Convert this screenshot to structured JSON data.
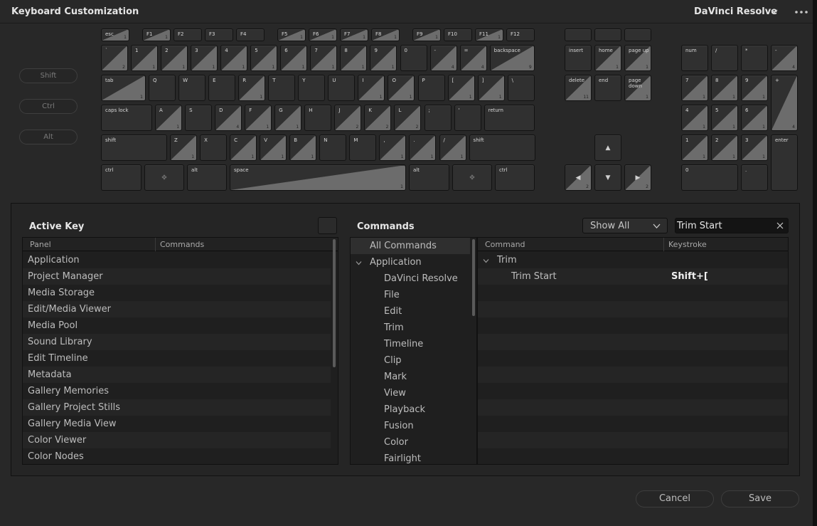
{
  "window": {
    "title": "Keyboard Customization",
    "preset": "DaVinci Resolve"
  },
  "modifiers": [
    "Shift",
    "Ctrl",
    "Alt"
  ],
  "keyboard": {
    "function_row": [
      {
        "label": "esc",
        "count": "1"
      },
      {
        "label": "F1",
        "count": "1"
      },
      {
        "label": "F2",
        "count": ""
      },
      {
        "label": "F3",
        "count": ""
      },
      {
        "label": "F4",
        "count": ""
      },
      {
        "label": "F5",
        "count": "1"
      },
      {
        "label": "F6",
        "count": "1"
      },
      {
        "label": "F7",
        "count": "1"
      },
      {
        "label": "F8",
        "count": "1"
      },
      {
        "label": "F9",
        "count": "1"
      },
      {
        "label": "F10",
        "count": ""
      },
      {
        "label": "F11",
        "count": "1"
      },
      {
        "label": "F12",
        "count": ""
      }
    ],
    "number_row": [
      {
        "label": "`",
        "count": "2"
      },
      {
        "label": "1",
        "count": "1"
      },
      {
        "label": "2",
        "count": "1"
      },
      {
        "label": "3",
        "count": "1"
      },
      {
        "label": "4",
        "count": "1"
      },
      {
        "label": "5",
        "count": "1"
      },
      {
        "label": "6",
        "count": "1"
      },
      {
        "label": "7",
        "count": "1"
      },
      {
        "label": "8",
        "count": "1"
      },
      {
        "label": "9",
        "count": "1"
      },
      {
        "label": "0",
        "count": ""
      },
      {
        "label": "-",
        "count": "4"
      },
      {
        "label": "=",
        "count": "4"
      },
      {
        "label": "backspace",
        "count": "9"
      }
    ],
    "tab_row": [
      {
        "label": "tab",
        "count": "1"
      },
      {
        "label": "Q",
        "count": ""
      },
      {
        "label": "W",
        "count": ""
      },
      {
        "label": "E",
        "count": ""
      },
      {
        "label": "R",
        "count": "1"
      },
      {
        "label": "T",
        "count": ""
      },
      {
        "label": "Y",
        "count": ""
      },
      {
        "label": "U",
        "count": ""
      },
      {
        "label": "I",
        "count": "1"
      },
      {
        "label": "O",
        "count": "1"
      },
      {
        "label": "P",
        "count": ""
      },
      {
        "label": "[",
        "count": "1"
      },
      {
        "label": "]",
        "count": "1"
      },
      {
        "label": "\\",
        "count": ""
      }
    ],
    "caps_row": [
      {
        "label": "caps lock",
        "count": ""
      },
      {
        "label": "A",
        "count": "1"
      },
      {
        "label": "S",
        "count": ""
      },
      {
        "label": "D",
        "count": "4"
      },
      {
        "label": "F",
        "count": "1"
      },
      {
        "label": "G",
        "count": "1"
      },
      {
        "label": "H",
        "count": ""
      },
      {
        "label": "J",
        "count": "2"
      },
      {
        "label": "K",
        "count": "2"
      },
      {
        "label": "L",
        "count": "2"
      },
      {
        "label": ";",
        "count": ""
      },
      {
        "label": "'",
        "count": ""
      },
      {
        "label": "return",
        "count": ""
      }
    ],
    "shift_row": [
      {
        "label": "shift",
        "count": ""
      },
      {
        "label": "Z",
        "count": "1"
      },
      {
        "label": "X",
        "count": ""
      },
      {
        "label": "C",
        "count": "1"
      },
      {
        "label": "V",
        "count": "1"
      },
      {
        "label": "B",
        "count": "1"
      },
      {
        "label": "N",
        "count": ""
      },
      {
        "label": "M",
        "count": ""
      },
      {
        "label": ",",
        "count": "1"
      },
      {
        "label": ".",
        "count": "1"
      },
      {
        "label": "/",
        "count": "1"
      },
      {
        "label": "shift",
        "count": ""
      }
    ],
    "bottom_row": [
      {
        "label": "ctrl",
        "count": ""
      },
      {
        "label": "",
        "count": "",
        "icon": "cmd-icon"
      },
      {
        "label": "alt",
        "count": ""
      },
      {
        "label": "space",
        "count": "1"
      },
      {
        "label": "alt",
        "count": ""
      },
      {
        "label": "",
        "count": "",
        "icon": "cmd-icon"
      },
      {
        "label": "ctrl",
        "count": ""
      }
    ],
    "nav_cluster": [
      {
        "label": "insert",
        "count": ""
      },
      {
        "label": "home",
        "count": "1"
      },
      {
        "label": "page up",
        "count": "1"
      },
      {
        "label": "delete",
        "count": "11"
      },
      {
        "label": "end",
        "count": ""
      },
      {
        "label": "page down",
        "count": "1"
      }
    ],
    "arrows": [
      {
        "label": "up-arrow",
        "count": ""
      },
      {
        "label": "left-arrow",
        "count": "2"
      },
      {
        "label": "down-arrow",
        "count": ""
      },
      {
        "label": "right-arrow",
        "count": "2"
      }
    ],
    "numpad": [
      {
        "label": "num",
        "count": ""
      },
      {
        "label": "/",
        "count": ""
      },
      {
        "label": "*",
        "count": ""
      },
      {
        "label": "-",
        "count": "4"
      },
      {
        "label": "7",
        "count": "1"
      },
      {
        "label": "8",
        "count": "1"
      },
      {
        "label": "9",
        "count": "1"
      },
      {
        "label": "+",
        "count": "4"
      },
      {
        "label": "4",
        "count": "1"
      },
      {
        "label": "5",
        "count": "1"
      },
      {
        "label": "6",
        "count": "1"
      },
      {
        "label": "1",
        "count": "1"
      },
      {
        "label": "2",
        "count": "1"
      },
      {
        "label": "3",
        "count": "1"
      },
      {
        "label": "enter",
        "count": ""
      },
      {
        "label": "0",
        "count": ""
      },
      {
        "label": ".",
        "count": ""
      }
    ]
  },
  "active_key": {
    "title": "Active Key",
    "columns": [
      "Panel",
      "Commands"
    ],
    "rows": [
      "Application",
      "Project Manager",
      "Media Storage",
      "Edit/Media Viewer",
      "Media Pool",
      "Sound Library",
      "Edit Timeline",
      "Metadata",
      "Gallery Memories",
      "Gallery Project Stills",
      "Gallery Media View",
      "Color Viewer",
      "Color Nodes"
    ]
  },
  "commands": {
    "title": "Commands",
    "filter": "Show All",
    "search_value": "Trim Start",
    "tree": [
      {
        "label": "All Commands",
        "level": 0,
        "selected": true
      },
      {
        "label": "Application",
        "level": 0,
        "expanded": true
      },
      {
        "label": "DaVinci Resolve",
        "level": 1
      },
      {
        "label": "File",
        "level": 1
      },
      {
        "label": "Edit",
        "level": 1
      },
      {
        "label": "Trim",
        "level": 1
      },
      {
        "label": "Timeline",
        "level": 1
      },
      {
        "label": "Clip",
        "level": 1
      },
      {
        "label": "Mark",
        "level": 1
      },
      {
        "label": "View",
        "level": 1
      },
      {
        "label": "Playback",
        "level": 1
      },
      {
        "label": "Fusion",
        "level": 1
      },
      {
        "label": "Color",
        "level": 1
      },
      {
        "label": "Fairlight",
        "level": 1
      }
    ],
    "columns": [
      "Command",
      "Keystroke"
    ],
    "results": [
      {
        "command": "Trim",
        "keystroke": "",
        "group": true
      },
      {
        "command": "Trim Start",
        "keystroke": "Shift+["
      }
    ]
  },
  "buttons": {
    "cancel": "Cancel",
    "save": "Save"
  },
  "colors": {
    "background": "#282828",
    "key": "#303030",
    "key_bound": "#6c6c6c",
    "accent_text": "#e6e6e6"
  }
}
